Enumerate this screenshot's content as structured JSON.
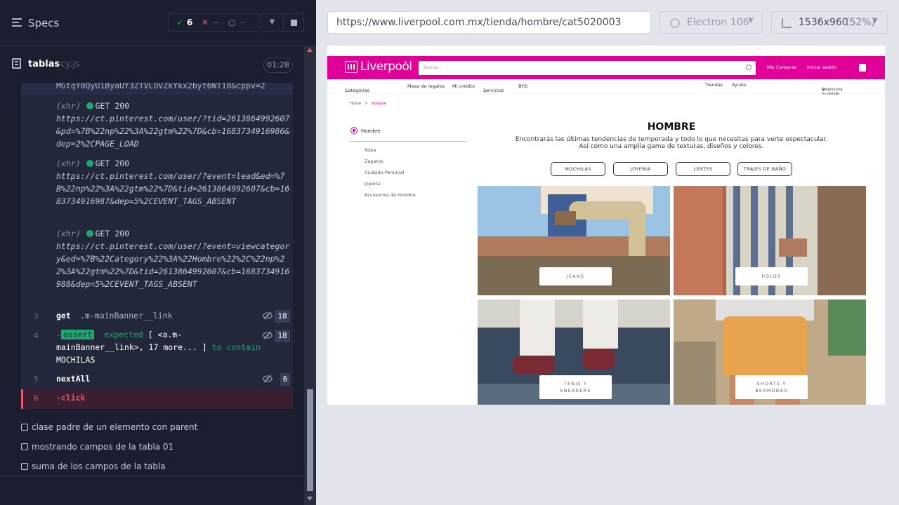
{
  "runner": {
    "specs_title": "Specs",
    "stats": {
      "passed": "6",
      "failed": "--",
      "pending": "--"
    },
    "file_name": "tablas",
    "file_ext": ".cy.js",
    "duration": "01:28"
  },
  "command_log": {
    "top_fragment": "MGtqY0QyU1ByaUY3ZTVLOVZkYkx2byt6WT18&cppv=2",
    "xhr_requests": [
      {
        "tag": "(xhr)",
        "status": "GET 200",
        "url": "https://ct.pinterest.com/user/?tid=2613864992607&pd=%7B%22np%22%3A%22gtm%22%7D&cb=1683734916986&dep=2%2CPAGE_LOAD"
      },
      {
        "tag": "(xhr)",
        "status": "GET 200",
        "url": "https://ct.pinterest.com/user/?event=lead&ed=%7B%22np%22%3A%22gtm%22%7D&tid=2613864992607&cb=1683734916987&dep=5%2CEVENT_TAGS_ABSENT"
      },
      {
        "tag": "(xhr)",
        "status": "GET 200",
        "url": "https://ct.pinterest.com/user/?event=viewcategory&ed=%7B%22Category%22%3A%22Hombre%22%2C%22np%22%3A%22gtm%22%7D&tid=2613864992607&cb=1683734916988&dep=5%2CEVENT_TAGS_ABSENT"
      }
    ],
    "commands": [
      {
        "num": "3",
        "name": "get",
        "arg": ".m-mainBanner__link",
        "count": "18"
      },
      {
        "num": "4",
        "dash": "-",
        "name": "assert",
        "text_expected": "expected",
        "text_obj": "[ <a.m-mainBanner__link>, 17 more... ]",
        "text_to": "to",
        "text_contain": "contain",
        "text_val": "MOCHILAS",
        "count": "18"
      },
      {
        "num": "5",
        "name": "nextAll",
        "count": "6"
      },
      {
        "num": "6",
        "name": "-click"
      }
    ],
    "suites": [
      "clase padre de un elemento con parent",
      "mostrando campos de la tabla 01",
      "suma de los campos de la tabla"
    ]
  },
  "aut_bar": {
    "url": "https://www.liverpool.com.mx/tienda/hombre/cat5020003",
    "browser": "Electron 106",
    "viewport": "1536x960",
    "scale": "(52%)"
  },
  "liverpool": {
    "logo": "Liverpool",
    "logo_mark": "®",
    "search_placeholder": "Buscar...",
    "mis_compras": "Mis Compras",
    "iniciar_sesion": "Iniciar sesión",
    "nav": {
      "categorias": "Categorías",
      "mesa_regalos": "Mesa de regalos",
      "mi_credito": "Mi crédito",
      "servicios": "Servicios",
      "byd": "BYD",
      "tiendas": "Tiendas",
      "ayuda": "Ayuda",
      "selecciona_tienda": "Selecciona tu tienda"
    },
    "breadcrumb": {
      "home": "Home",
      "sep": ">",
      "current": "Hombre"
    },
    "sidebar": {
      "title": "Hombre",
      "items": [
        "Ropa",
        "Zapatos",
        "Cuidado Personal",
        "Joyería",
        "Accesorios de Hombre"
      ]
    },
    "heading": "HOMBRE",
    "desc_line1": "Encontrarás las últimas tendencias de temporada y todo lo que necesitas para verte espectacular.",
    "desc_line2": "Así como una amplia gama de texturas, diseños y colores.",
    "pills": [
      "MOCHILAS",
      "JOYERÍA",
      "LENTES",
      "TRAJES DE BAÑO"
    ],
    "tiles": [
      {
        "line1": "JEANS",
        "line2": ""
      },
      {
        "line1": "POLOS",
        "line2": ""
      },
      {
        "line1": "TENIS Y",
        "line2": "SNEAKERS"
      },
      {
        "line1": "SHORTS Y",
        "line2": "BERMUDAS"
      }
    ],
    "brand_color": "#e10098"
  }
}
